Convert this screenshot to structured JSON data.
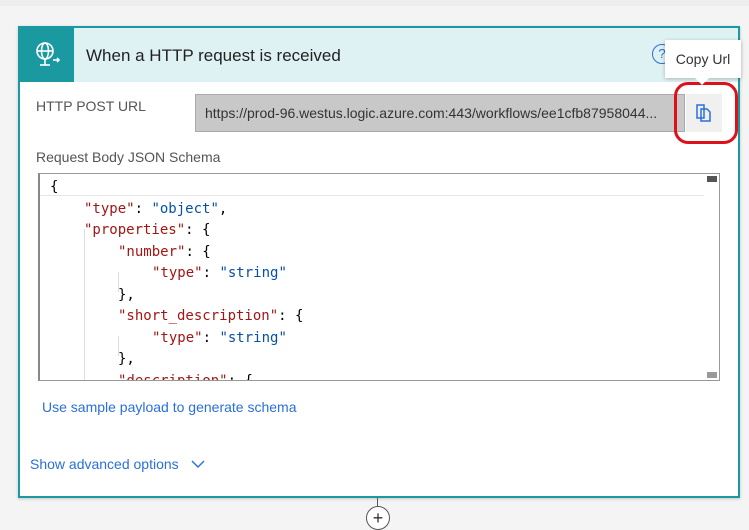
{
  "card": {
    "title": "When a HTTP request is received",
    "help": "?"
  },
  "tooltip": "Copy Url",
  "url_label": "HTTP POST URL",
  "url_value": "https://prod-96.westus.logic.azure.com:443/workflows/ee1cfb87958044...",
  "schema_label": "Request Body JSON Schema",
  "schema_lines": [
    [
      {
        "t": "{",
        "c": "p"
      }
    ],
    [
      {
        "t": "\"type\"",
        "c": "k"
      },
      {
        "t": ": ",
        "c": "p"
      },
      {
        "t": "\"object\"",
        "c": "s"
      },
      {
        "t": ",",
        "c": "p"
      }
    ],
    [
      {
        "t": "\"properties\"",
        "c": "k"
      },
      {
        "t": ": {",
        "c": "p"
      }
    ],
    [
      {
        "t": "\"number\"",
        "c": "k"
      },
      {
        "t": ": {",
        "c": "p"
      }
    ],
    [
      {
        "t": "\"type\"",
        "c": "k"
      },
      {
        "t": ": ",
        "c": "p"
      },
      {
        "t": "\"string\"",
        "c": "s"
      }
    ],
    [
      {
        "t": "},",
        "c": "p"
      }
    ],
    [
      {
        "t": "\"short_description\"",
        "c": "k"
      },
      {
        "t": ": {",
        "c": "p"
      }
    ],
    [
      {
        "t": "\"type\"",
        "c": "k"
      },
      {
        "t": ": ",
        "c": "p"
      },
      {
        "t": "\"string\"",
        "c": "s"
      }
    ],
    [
      {
        "t": "},",
        "c": "p"
      }
    ],
    [
      {
        "t": "\"description\"",
        "c": "k"
      },
      {
        "t": ": {",
        "c": "p"
      }
    ]
  ],
  "schema_indent": [
    0,
    1,
    1,
    2,
    3,
    2,
    2,
    3,
    2,
    2
  ],
  "sample_link": "Use sample payload to generate schema",
  "advanced_link": "Show advanced options",
  "add_step": "+"
}
